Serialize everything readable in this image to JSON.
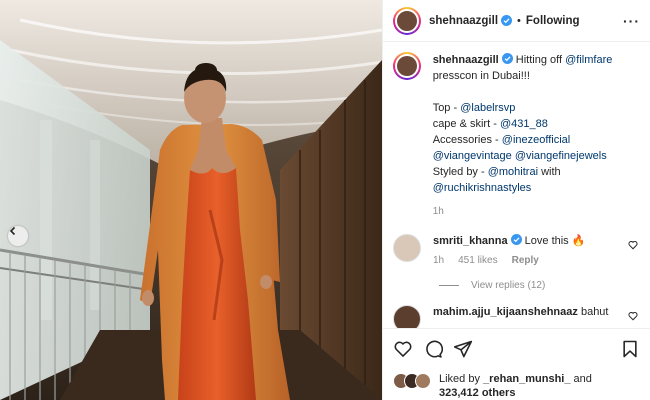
{
  "post": {
    "username": "shehnaazgill",
    "separator": "•",
    "follow_state": "Following",
    "more_label": "···"
  },
  "caption": {
    "username": "shehnaazgill",
    "line1": "Hitting off",
    "mention_filmfare": "@filmfare",
    "line2": "presscon in Dubai!!!",
    "top_label": "Top -",
    "top_mention": "@labelrsvp",
    "cape_label": "cape & skirt -",
    "cape_mention": "@431_88",
    "acc_label": "Accessories -",
    "acc_mention1": "@inezeofficial",
    "acc_mention2": "@viangevintage",
    "acc_mention3": "@viangefinejewels",
    "styled_label": "Styled by -",
    "styled_mention1": "@mohitrai",
    "styled_with": "with",
    "styled_mention2": "@ruchikrishnastyles",
    "time": "1h"
  },
  "comments": [
    {
      "username": "smriti_khanna",
      "text": "Love this",
      "emoji": "🔥",
      "time": "1h",
      "likes": "451 likes",
      "reply": "Reply",
      "view_replies": "View replies (12)"
    },
    {
      "username": "mahim.ajju_kijaanshehnaaz",
      "text": "bahut"
    }
  ],
  "likes": {
    "prefix": "Liked by",
    "user": "_rehan_munshi_",
    "and": "and",
    "others": "323,412 others"
  },
  "icons": {
    "verified": "verified-badge-icon",
    "heart": "heart-icon",
    "comment": "comment-icon",
    "share": "paper-plane-icon",
    "save": "bookmark-icon",
    "prev": "chevron-left-icon"
  },
  "colors": {
    "verified_blue": "#3897f0",
    "link": "#00376b",
    "muted": "#8e8e8e",
    "dress_orange": "#e05a22",
    "coat_orange": "#d9803a"
  }
}
